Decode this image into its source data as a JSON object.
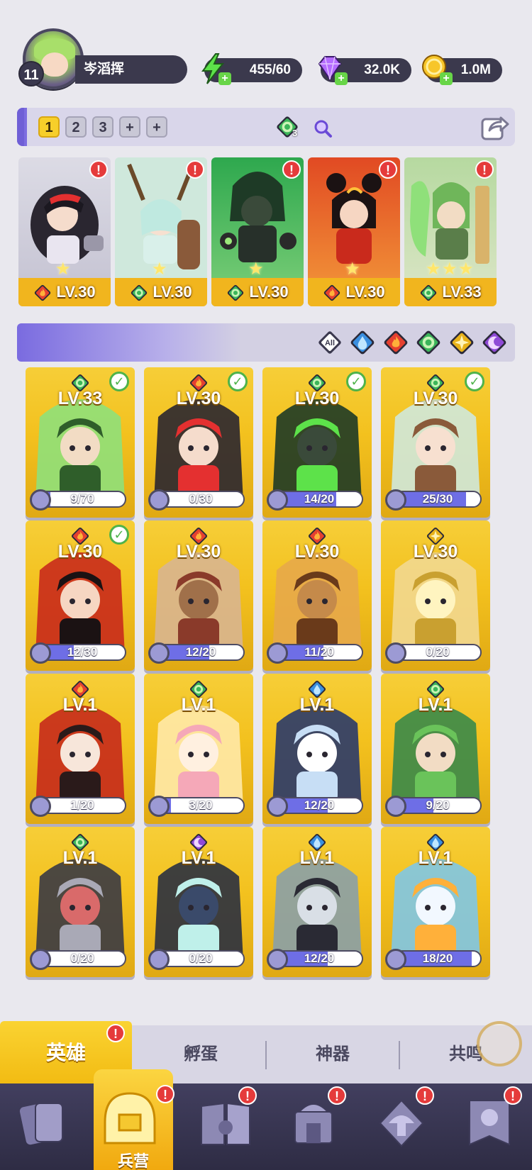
{
  "player": {
    "level": "11",
    "name": "岑滔挥"
  },
  "resources": {
    "energy": "455/60",
    "gems": "32.0K",
    "gold": "1.0M"
  },
  "team": {
    "tabs": [
      "1",
      "2",
      "3",
      "+",
      "+"
    ],
    "active_tab": "1",
    "gem_count": "3"
  },
  "lineup": [
    {
      "element": "fire",
      "level": "LV.30",
      "stars": 1
    },
    {
      "element": "nature",
      "level": "LV.30",
      "stars": 1
    },
    {
      "element": "nature",
      "level": "LV.30",
      "stars": 1
    },
    {
      "element": "fire",
      "level": "LV.30",
      "stars": 1
    },
    {
      "element": "nature",
      "level": "LV.33",
      "stars": 3
    }
  ],
  "filters": [
    "All",
    "water",
    "fire",
    "nature",
    "light",
    "dark"
  ],
  "heroes": [
    {
      "element": "nature",
      "level": "LV.33",
      "progress": "9/70",
      "checked": true
    },
    {
      "element": "fire",
      "level": "LV.30",
      "progress": "0/30",
      "checked": true
    },
    {
      "element": "nature",
      "level": "LV.30",
      "progress": "14/20",
      "checked": true
    },
    {
      "element": "nature",
      "level": "LV.30",
      "progress": "25/30",
      "checked": true
    },
    {
      "element": "fire",
      "level": "LV.30",
      "progress": "12/30",
      "checked": true
    },
    {
      "element": "fire",
      "level": "LV.30",
      "progress": "12/20",
      "checked": false
    },
    {
      "element": "fire",
      "level": "LV.30",
      "progress": "11/20",
      "checked": false
    },
    {
      "element": "light",
      "level": "LV.30",
      "progress": "0/20",
      "checked": false
    },
    {
      "element": "fire",
      "level": "LV.1",
      "progress": "1/20",
      "checked": false
    },
    {
      "element": "nature",
      "level": "LV.1",
      "progress": "3/20",
      "checked": false
    },
    {
      "element": "water",
      "level": "LV.1",
      "progress": "12/20",
      "checked": false
    },
    {
      "element": "nature",
      "level": "LV.1",
      "progress": "9/20",
      "checked": false
    },
    {
      "element": "nature",
      "level": "LV.1",
      "progress": "0/20",
      "checked": false
    },
    {
      "element": "dark",
      "level": "LV.1",
      "progress": "0/20",
      "checked": false
    },
    {
      "element": "water",
      "level": "LV.1",
      "progress": "12/20",
      "checked": false
    },
    {
      "element": "water",
      "level": "LV.1",
      "progress": "18/20",
      "checked": false
    }
  ],
  "subtabs": {
    "hero": "英雄",
    "egg": "孵蛋",
    "artifact": "神器",
    "resonance": "共鸣"
  },
  "bottom_nav": {
    "active_label": "兵营",
    "items": [
      "cards-icon",
      "barracks-icon",
      "book-icon",
      "shrine-icon",
      "mushroom-icon",
      "banner-icon"
    ]
  },
  "badge": "!",
  "colors": {
    "gold": "#f3c11e",
    "purple": "#7a6be0",
    "nav": "#2e2c44",
    "fire": "#e5402f",
    "nature": "#3cb55a",
    "water": "#3a8fe0",
    "light": "#e8b21a",
    "dark": "#8f4ad6"
  }
}
